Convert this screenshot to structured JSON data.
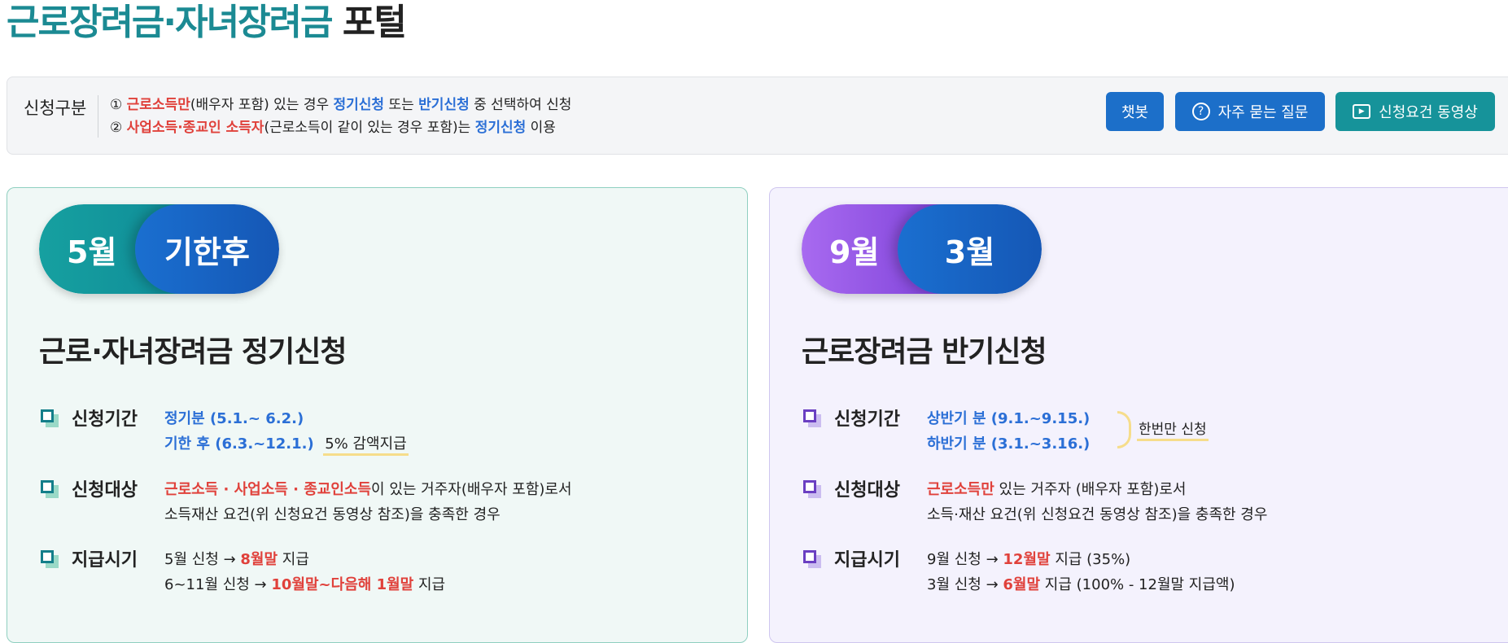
{
  "header": {
    "title_highlight": "근로장려금·자녀장려금",
    "title_rest": "포털"
  },
  "notice": {
    "label": "신청구분",
    "line1": {
      "num": "①",
      "red": "근로소득만",
      "t1": "(배우자 포함) 있는 경우",
      "blue1": "정기신청",
      "t2": "또는",
      "blue2": "반기신청",
      "t3": "중 선택하여 신청"
    },
    "line2": {
      "num": "②",
      "red": "사업소득·종교인 소득자",
      "t1": "(근로소득이 같이 있는 경우 포함)는",
      "blue1": "정기신청",
      "t2": "이용"
    }
  },
  "buttons": {
    "chatbot": "챗봇",
    "faq": "자주 묻는 질문",
    "faq_icon": "?",
    "video": "신청요건 동영상",
    "video_icon": "▶"
  },
  "colors": {
    "brand_teal": "#1b8a93",
    "accent_blue": "#2b6fd6",
    "accent_red": "#e0413b",
    "button_blue": "#1c6fc9",
    "button_teal": "#16939a"
  },
  "regular": {
    "pill_left": "5월",
    "pill_right": "기한후",
    "title": "근로·자녀장려금 정기신청",
    "period_label": "신청기간",
    "period_line1": "정기분 (5.1.~ 6.2.)",
    "period_line2_blue": "기한 후 (6.3.~12.1.)",
    "period_line2_note": "5% 감액지급",
    "target_label": "신청대상",
    "target_line1_red": "근로소득 · 사업소득 · 종교인소득",
    "target_line1_rest": "이 있는 거주자(배우자 포함)로서",
    "target_line2": "소득재산 요건(위 신청요건 동영상 참조)을 충족한 경우",
    "pay_label": "지급시기",
    "pay_line1_a": "5월 신청 →",
    "pay_line1_red": "8월말",
    "pay_line1_b": "지급",
    "pay_line2_a": "6~11월 신청 →",
    "pay_line2_red": "10월말~다음해 1월말",
    "pay_line2_b": "지급"
  },
  "semiannual": {
    "pill_left": "9월",
    "pill_right": "3월",
    "title": "근로장려금 반기신청",
    "period_label": "신청기간",
    "period_line1": "상반기 분 (9.1.~9.15.)",
    "period_line2": "하반기 분 (3.1.~3.16.)",
    "period_note": "한번만 신청",
    "target_label": "신청대상",
    "target_line1_red": "근로소득만",
    "target_line1_rest": "있는 거주자 (배우자 포함)로서",
    "target_line2": "소득·재산 요건(위 신청요건 동영상 참조)을 충족한 경우",
    "pay_label": "지급시기",
    "pay_line1_a": "9월 신청 →",
    "pay_line1_red": "12월말",
    "pay_line1_b": "지급 (35%)",
    "pay_line2_a": "3월 신청 →",
    "pay_line2_red": "6월말",
    "pay_line2_b": "지급 (100% - 12월말 지급액)"
  }
}
